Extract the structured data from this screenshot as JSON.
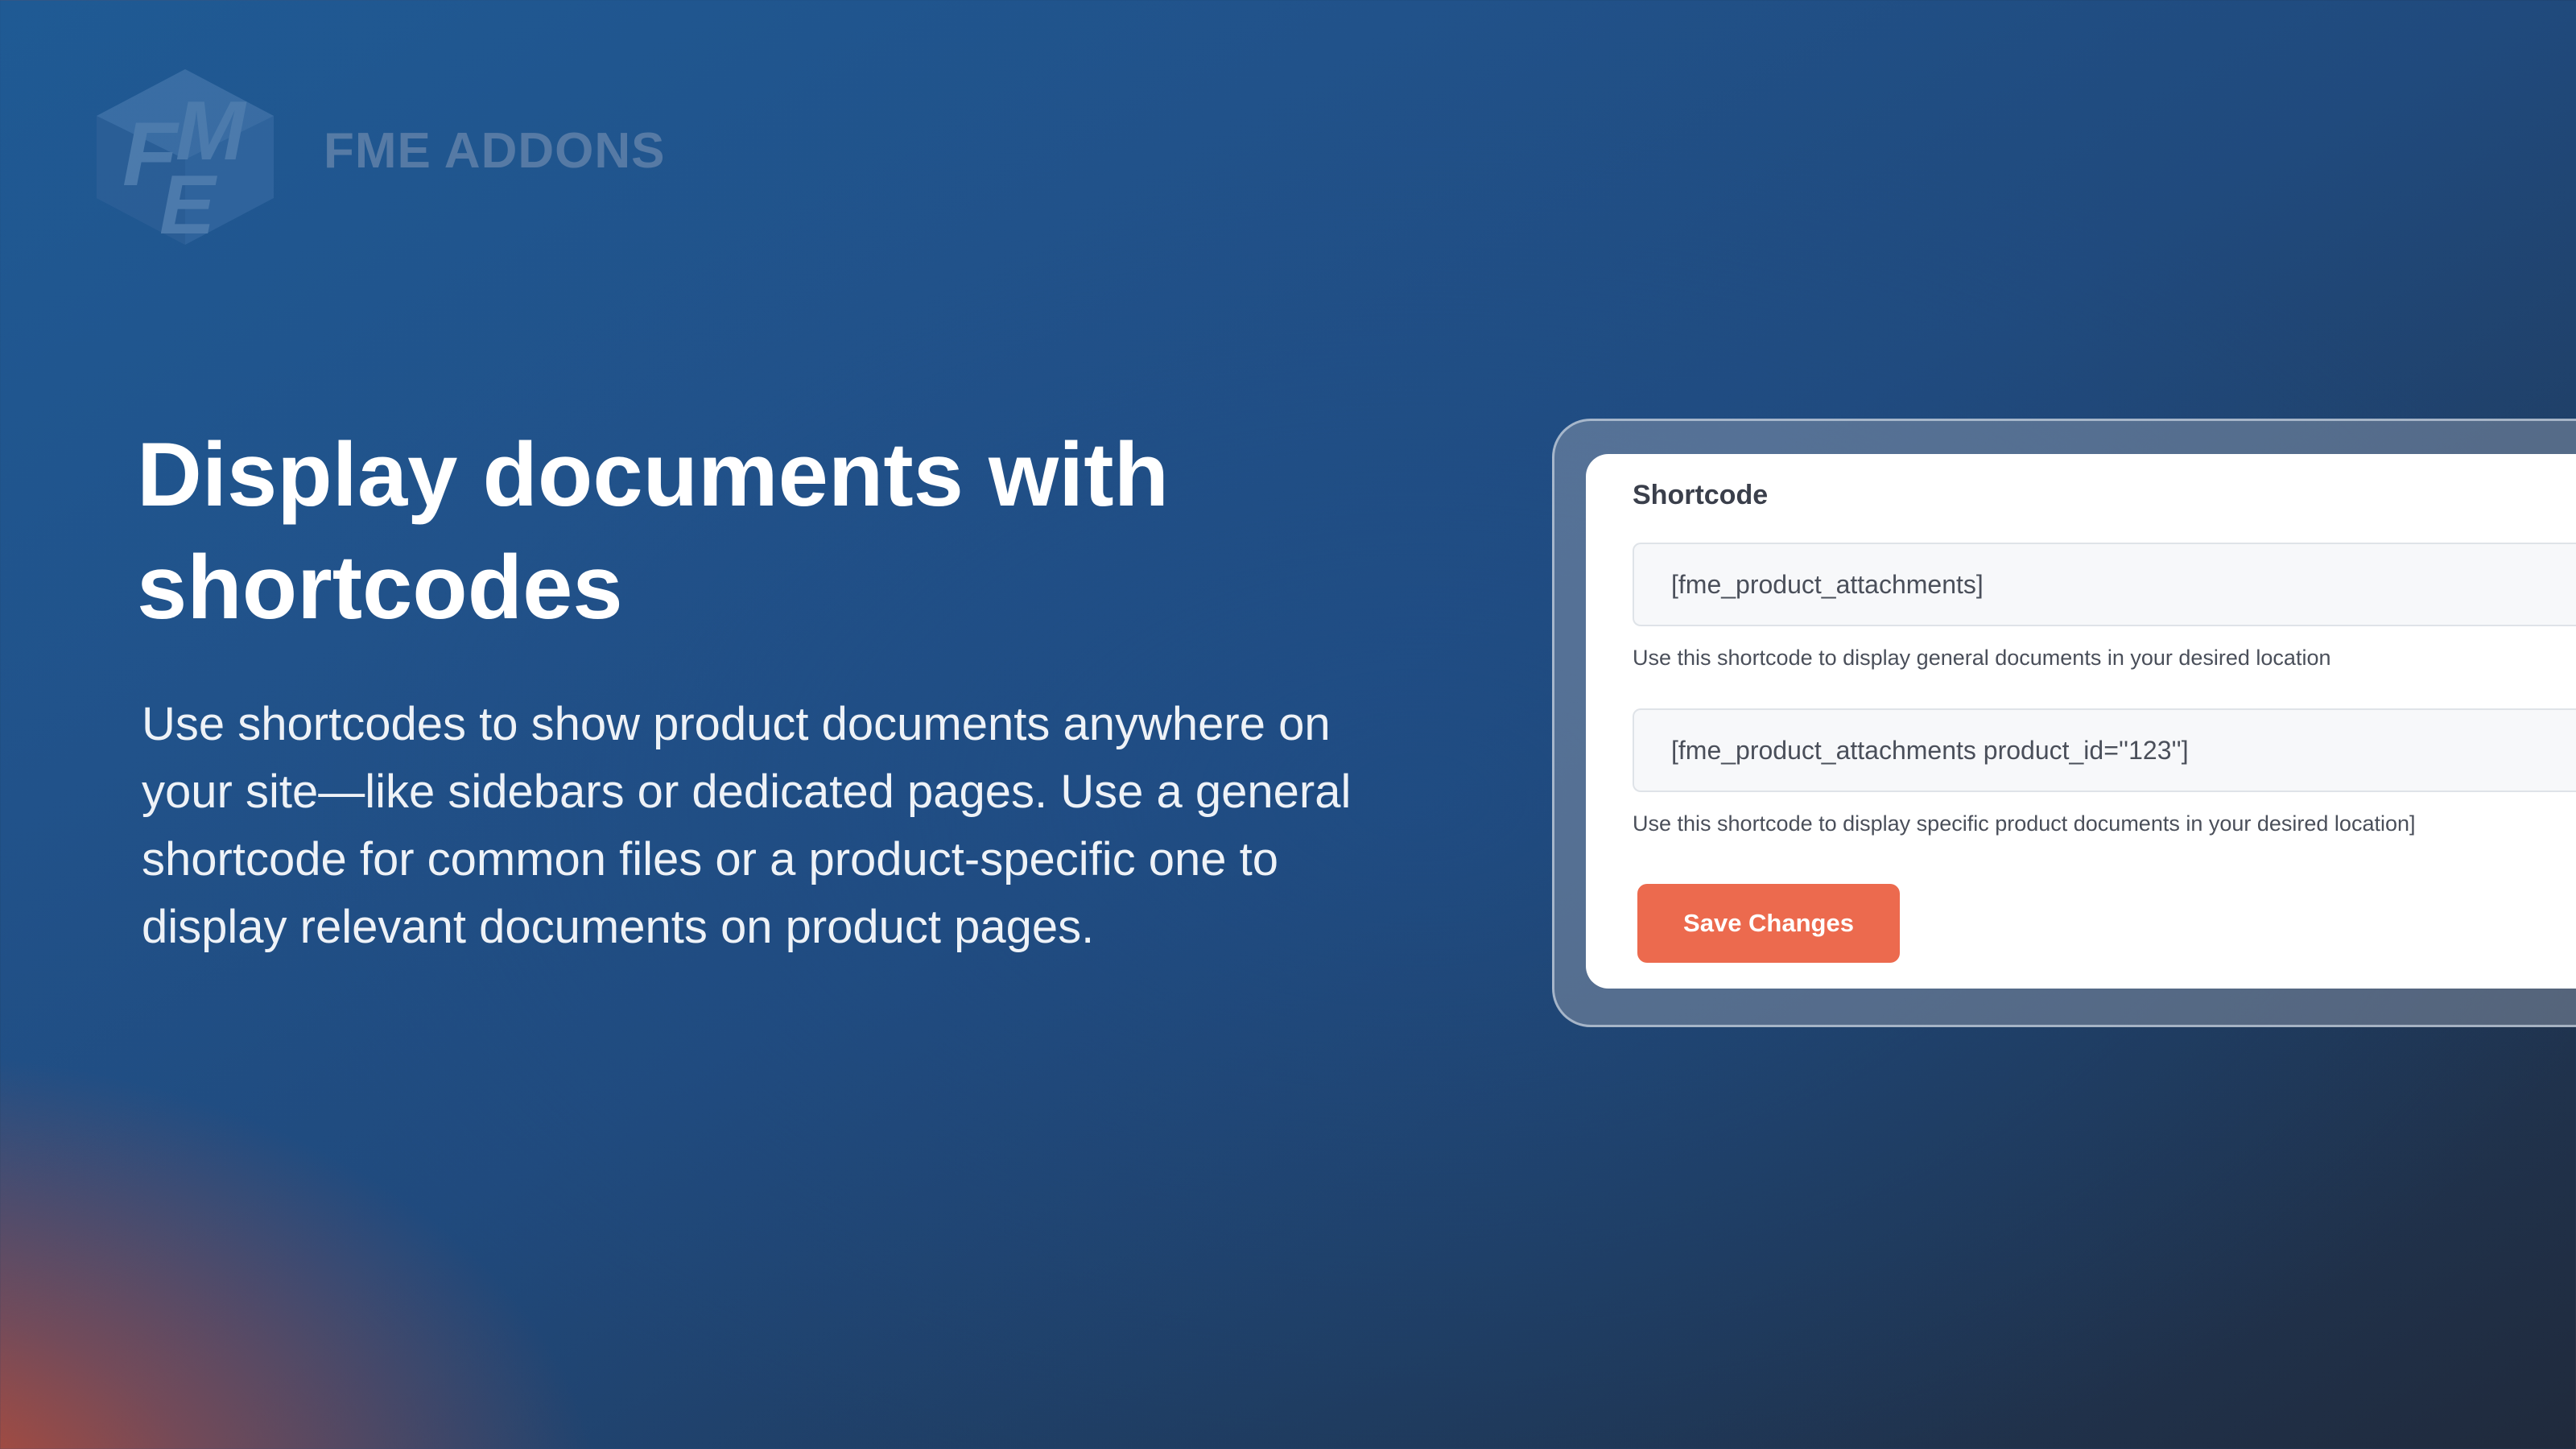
{
  "brand": {
    "name": "FME ADDONS",
    "logo_letters": "FME"
  },
  "hero": {
    "headline_line1": "Display documents with",
    "headline_line2": "shortcodes",
    "description": "Use shortcodes to show product documents anywhere on your site—like sidebars or dedicated pages. Use a general shortcode for common files or a product-specific one to display relevant documents on product pages."
  },
  "settings_card": {
    "title": "Shortcode",
    "general_shortcode": {
      "value": "[fme_product_attachments]",
      "help": "Use this shortcode to display general documents in your desired location"
    },
    "product_shortcode": {
      "value": "[fme_product_attachments product_id=''123'']",
      "help": "Use this shortcode to display specific product documents in your desired location]"
    },
    "save_label": "Save Changes"
  },
  "colors": {
    "accent": "#ec6a4e",
    "background_blue": "#1f5a94",
    "background_dark": "#202a3c",
    "background_orange": "#d64c28"
  }
}
